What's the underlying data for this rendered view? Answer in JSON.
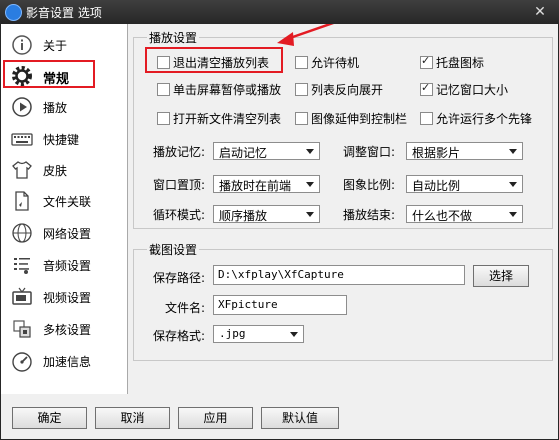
{
  "window": {
    "title": "影音设置 选项",
    "close_glyph": "✕"
  },
  "sidebar": {
    "items": [
      {
        "label": "关于",
        "icon": "info-icon"
      },
      {
        "label": "常规",
        "icon": "gear-icon",
        "active": true
      },
      {
        "label": "播放",
        "icon": "play-icon"
      },
      {
        "label": "快捷键",
        "icon": "keyboard-icon"
      },
      {
        "label": "皮肤",
        "icon": "shirt-icon"
      },
      {
        "label": "文件关联",
        "icon": "document-icon"
      },
      {
        "label": "网络设置",
        "icon": "globe-icon"
      },
      {
        "label": "音频设置",
        "icon": "audio-icon"
      },
      {
        "label": "视频设置",
        "icon": "tv-icon"
      },
      {
        "label": "多核设置",
        "icon": "cpu-icon"
      },
      {
        "label": "加速信息",
        "icon": "speedometer-icon"
      }
    ]
  },
  "playback": {
    "title": "播放设置",
    "checkboxes": [
      {
        "label": "退出清空播放列表",
        "checked": false
      },
      {
        "label": "允许待机",
        "checked": false
      },
      {
        "label": "托盘图标",
        "checked": true
      },
      {
        "label": "单击屏幕暂停或播放",
        "checked": false
      },
      {
        "label": "列表反向展开",
        "checked": false
      },
      {
        "label": "记忆窗口大小",
        "checked": true
      },
      {
        "label": "打开新文件清空列表",
        "checked": false
      },
      {
        "label": "图像延伸到控制栏",
        "checked": false
      },
      {
        "label": "允许运行多个先锋",
        "checked": false
      }
    ],
    "selects": [
      {
        "label": "播放记忆:",
        "value": "启动记忆"
      },
      {
        "label": "调整窗口:",
        "value": "根据影片"
      },
      {
        "label": "窗口置顶:",
        "value": "播放时在前端"
      },
      {
        "label": "图象比例:",
        "value": "自动比例"
      },
      {
        "label": "循环模式:",
        "value": "顺序播放"
      },
      {
        "label": "播放结束:",
        "value": "什么也不做"
      }
    ]
  },
  "capture": {
    "title": "截图设置",
    "path_label": "保存路径:",
    "path_value": "D:\\xfplay\\XfCapture",
    "browse_label": "选择",
    "filename_label": "文件名:",
    "filename_value": "XFpicture",
    "format_label": "保存格式:",
    "format_value": ".jpg"
  },
  "footer": {
    "ok_label": "确定",
    "cancel_label": "取消",
    "apply_label": "应用",
    "default_label": "默认值"
  },
  "colors": {
    "highlight": "#e31b23",
    "titlebar": "#262626",
    "background": "#f0f0f0"
  }
}
